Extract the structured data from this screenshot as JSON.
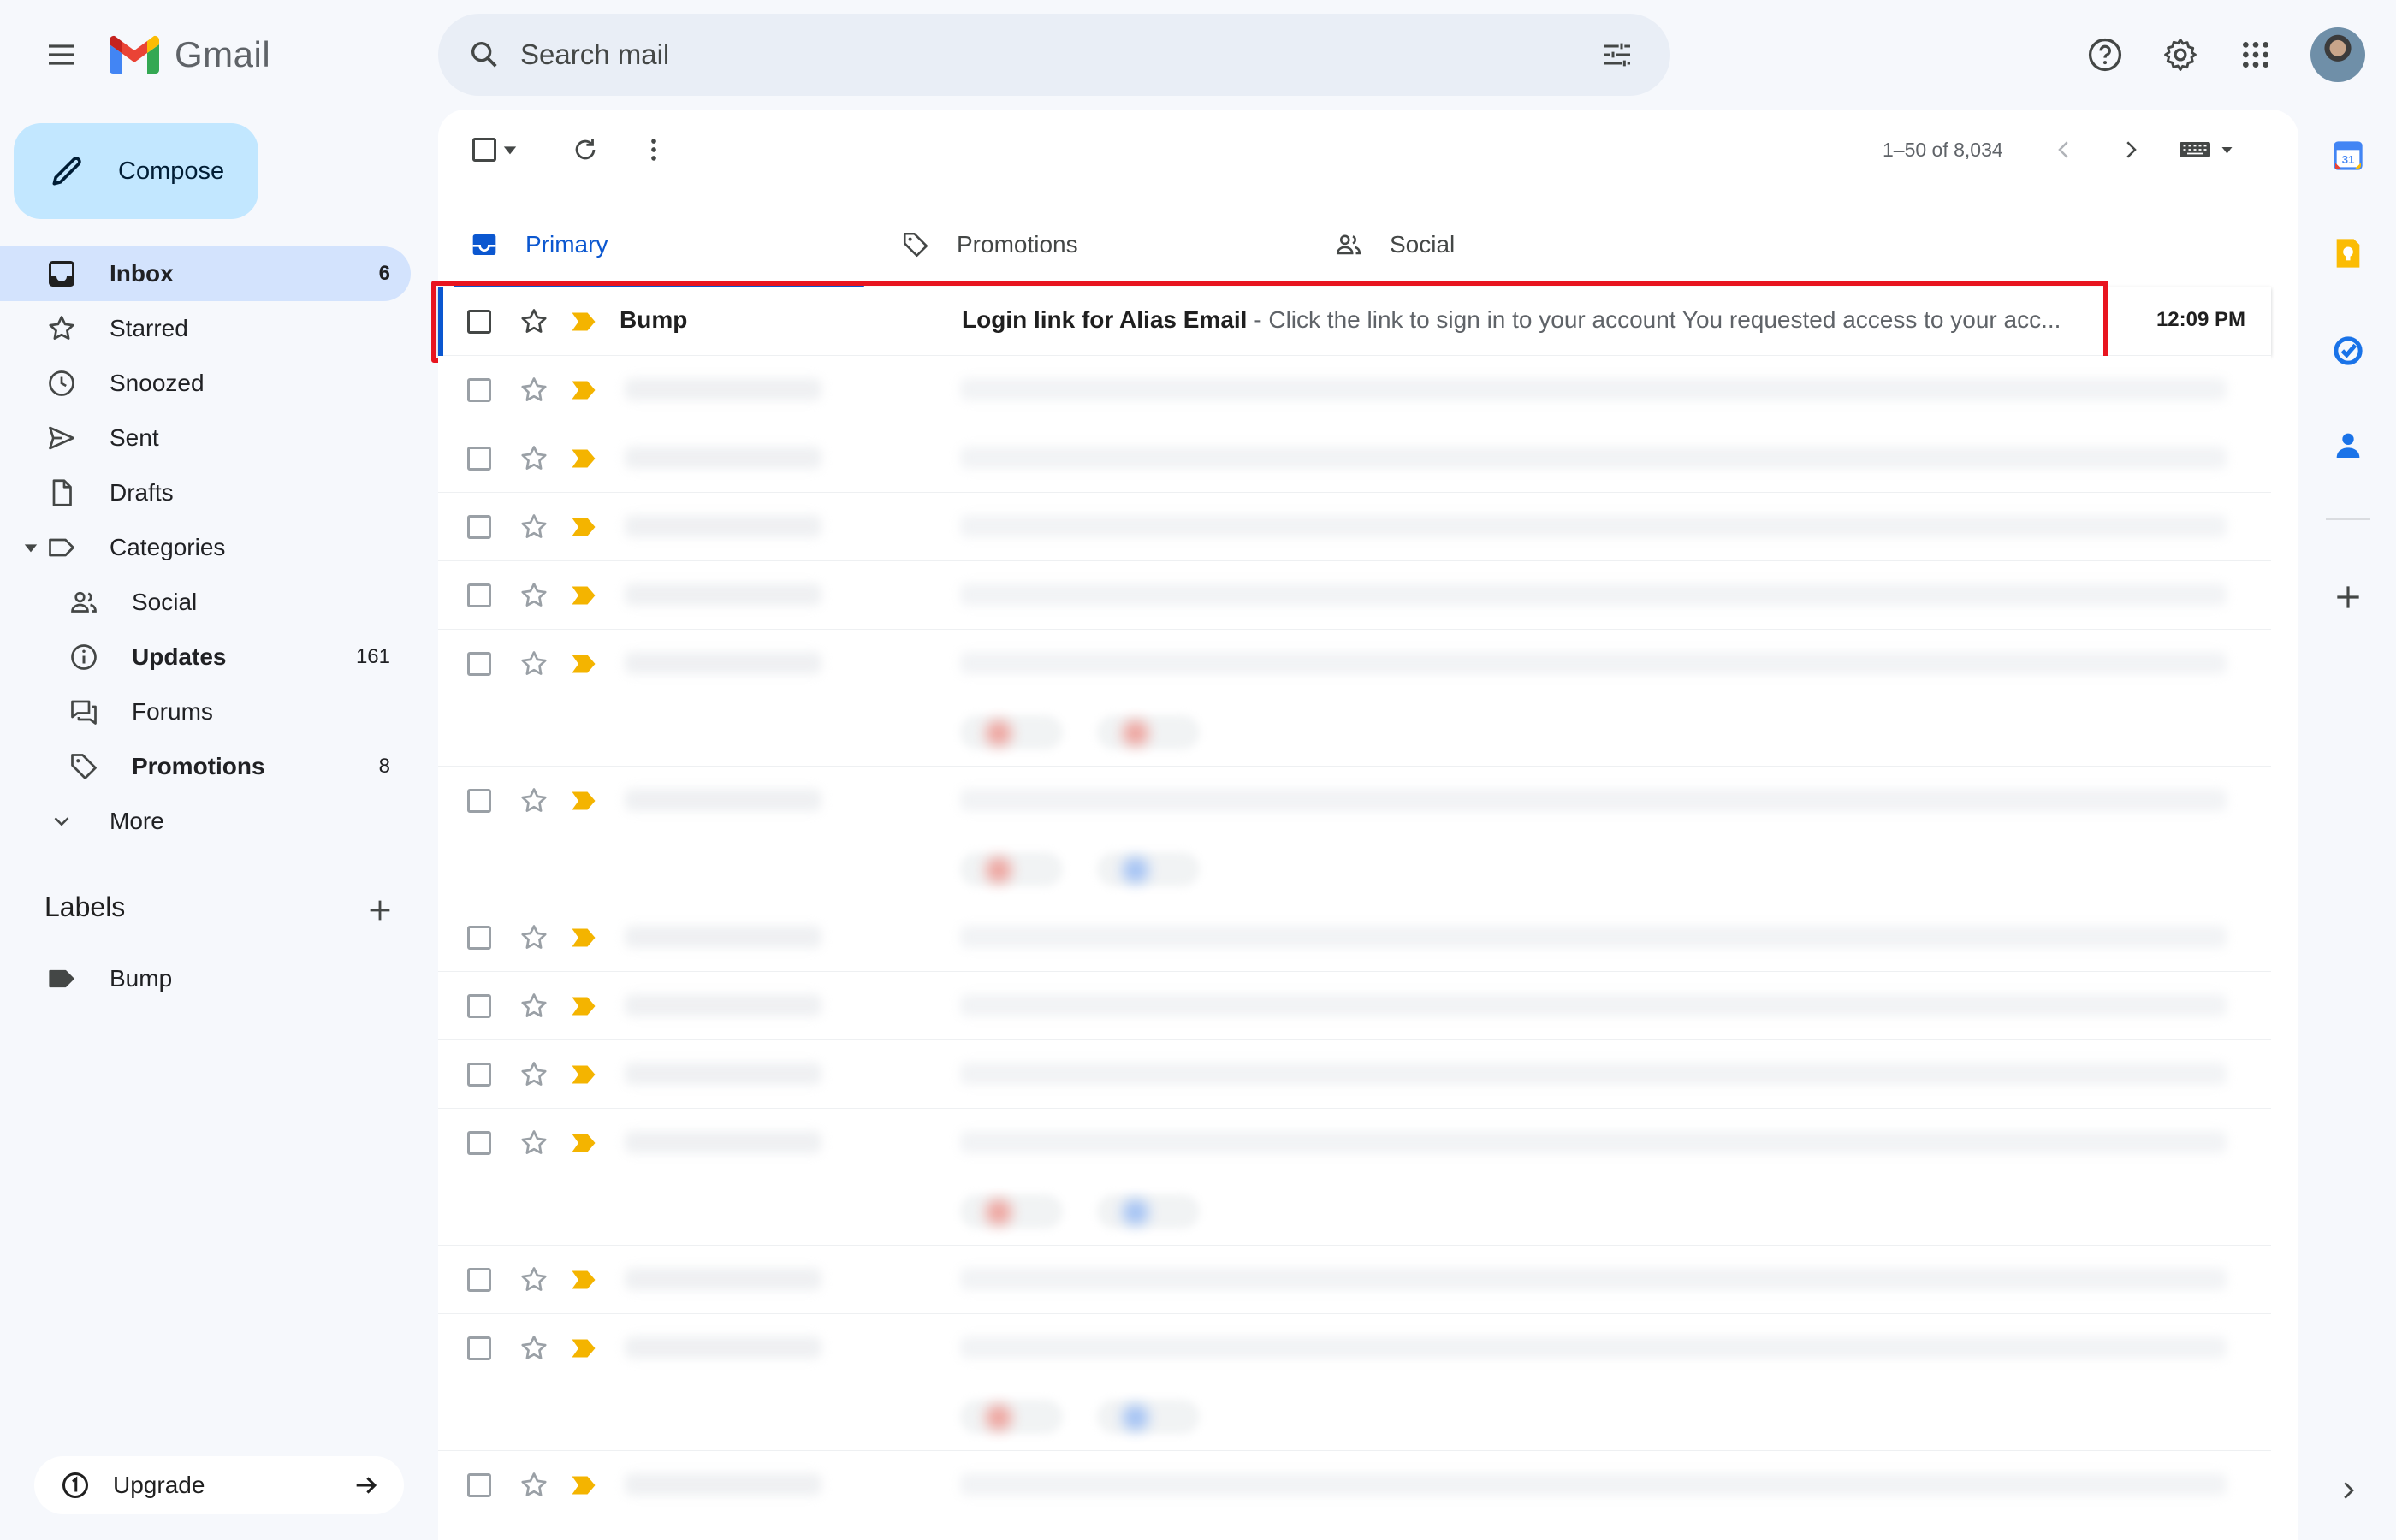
{
  "app": {
    "name": "Gmail"
  },
  "search": {
    "placeholder": "Search mail"
  },
  "compose": {
    "label": "Compose"
  },
  "nav": [
    {
      "label": "Inbox",
      "count": "6",
      "icon": "inbox-icon",
      "active": true
    },
    {
      "label": "Starred",
      "icon": "star-icon"
    },
    {
      "label": "Snoozed",
      "icon": "clock-icon"
    },
    {
      "label": "Sent",
      "icon": "send-icon"
    },
    {
      "label": "Drafts",
      "icon": "draft-icon"
    },
    {
      "label": "Categories",
      "icon": "label-icon"
    }
  ],
  "categories": [
    {
      "label": "Social",
      "icon": "people-icon"
    },
    {
      "label": "Updates",
      "count": "161",
      "icon": "info-icon"
    },
    {
      "label": "Forums",
      "icon": "forum-icon"
    },
    {
      "label": "Promotions",
      "count": "8",
      "icon": "tag-icon"
    }
  ],
  "more": {
    "label": "More"
  },
  "labels": {
    "title": "Labels",
    "items": [
      {
        "label": "Bump",
        "icon": "label-filled-icon"
      }
    ]
  },
  "upgrade": {
    "label": "Upgrade"
  },
  "toolbar": {
    "pager": "1–50 of 8,034"
  },
  "tabs": [
    {
      "label": "Primary",
      "icon": "inbox-tab-icon",
      "active": true
    },
    {
      "label": "Promotions",
      "icon": "tag-icon"
    },
    {
      "label": "Social",
      "icon": "people-icon"
    }
  ],
  "emails": [
    {
      "sender": "Bump",
      "subject": "Login link for Alias Email",
      "snippet": " - Click the link to sign in to your account You requested access to your acc...",
      "time": "12:09 PM",
      "unread": true,
      "important": true,
      "highlighted": true
    }
  ],
  "side_apps": [
    "calendar-icon",
    "keep-icon",
    "tasks-icon",
    "contacts-icon"
  ],
  "colors": {
    "accent": "#0b57d0",
    "compose_bg": "#c2e7ff",
    "active_nav": "#d3e3fd",
    "important": "#f4b400",
    "highlight": "#e8141f"
  }
}
